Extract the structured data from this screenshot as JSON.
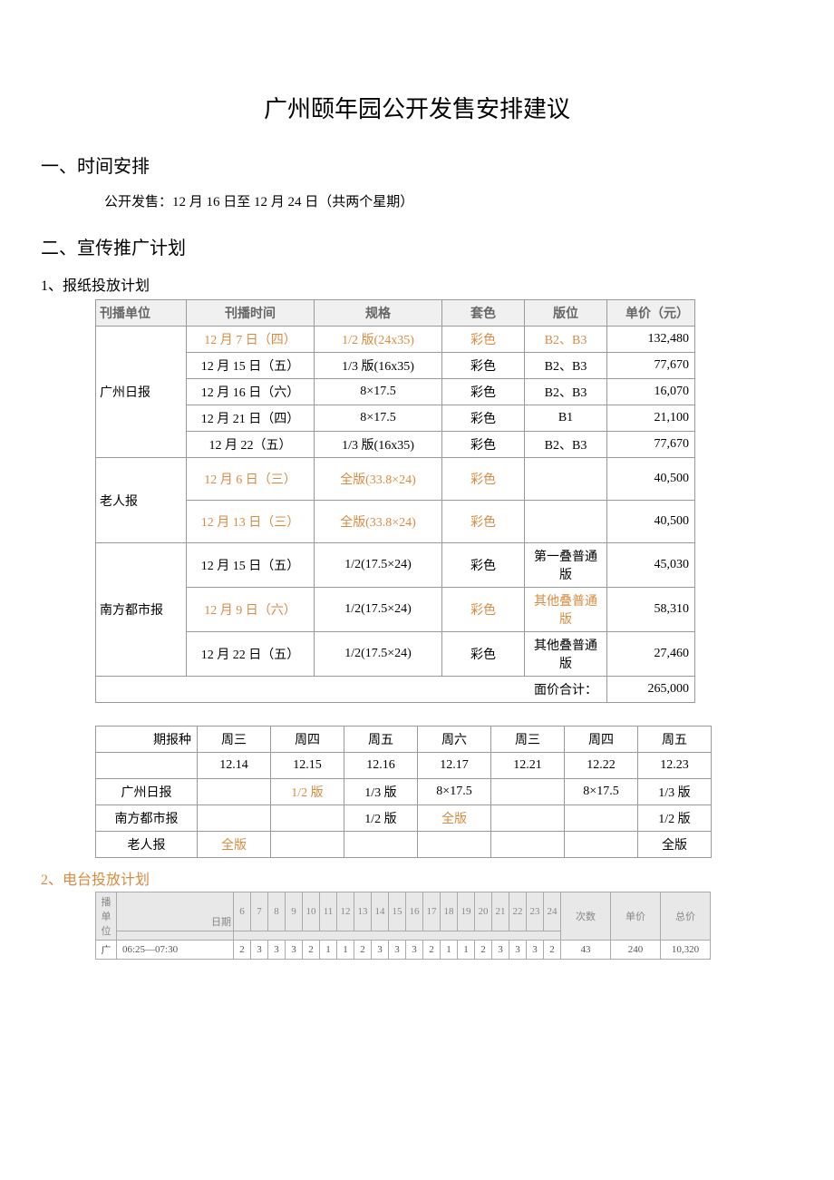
{
  "title": "广州颐年园公开发售安排建议",
  "h2a": "一、时间安排",
  "sale_line_prefix": "公开发售：",
  "sale_line_dates": "12 月 16 日至 12 月 24 日（共两个星期）",
  "h2b": "二、宣传推广计划",
  "s1": "1、报纸投放计划",
  "t1_headers": {
    "a": "刊播单位",
    "b": "刊播时间",
    "c": "规格",
    "d": "套色",
    "e": "版位",
    "f": "单价（元）"
  },
  "t1": [
    {
      "pub": "广州日报",
      "time": "12 月 7 日（四）",
      "spec": "1/2 版(24x35)",
      "color": "彩色",
      "pos": "B2、B3",
      "price": "132,480",
      "orange": true
    },
    {
      "pub": "",
      "time": "12 月 15 日（五）",
      "spec": "1/3 版(16x35)",
      "color": "彩色",
      "pos": "B2、B3",
      "price": "77,670"
    },
    {
      "pub": "",
      "time": "12 月 16 日（六）",
      "spec": "8×17.5",
      "color": "彩色",
      "pos": "B2、B3",
      "price": "16,070"
    },
    {
      "pub": "",
      "time": "12 月 21 日（四）",
      "spec": "8×17.5",
      "color": "彩色",
      "pos": "B1",
      "price": "21,100"
    },
    {
      "pub": "",
      "time": "12 月 22（五）",
      "spec": "1/3 版(16x35)",
      "color": "彩色",
      "pos": "B2、B3",
      "price": "77,670"
    },
    {
      "pub": "老人报",
      "time": "12 月 6 日（三）",
      "spec": "全版(33.8×24)",
      "color": "彩色",
      "pos": "",
      "price": "40,500",
      "orange": true,
      "tall": true
    },
    {
      "pub": "",
      "time": "12 月 13 日（三）",
      "spec": "全版(33.8×24)",
      "color": "彩色",
      "pos": "",
      "price": "40,500",
      "orange": true,
      "tall": true
    },
    {
      "pub": "南方都市报",
      "time": "12 月 15 日（五）",
      "spec": "1/2(17.5×24)",
      "color": "彩色",
      "pos": "第一叠普通版",
      "price": "45,030",
      "tall": true
    },
    {
      "pub": "",
      "time": "12 月 9 日（六）",
      "spec": "1/2(17.5×24)",
      "color": "彩色",
      "pos": "其他叠普通版",
      "price": "58,310",
      "orange": true,
      "tall": true
    },
    {
      "pub": "",
      "time": "12 月 22 日（五）",
      "spec": "1/2(17.5×24)",
      "color": "彩色",
      "pos": "其他叠普通版",
      "price": "27,460",
      "tall": true
    }
  ],
  "t1_total_label": "面价合计：",
  "t1_total": "265,000",
  "t2_corner": "期报种",
  "t2_days": [
    "周三",
    "周四",
    "周五",
    "周六",
    "周三",
    "周四",
    "周五"
  ],
  "t2_dates": [
    "12.14",
    "12.15",
    "12.16",
    "12.17",
    "12.21",
    "12.22",
    "12.23"
  ],
  "t2_rows": [
    {
      "name": "广州日报",
      "cells": [
        "",
        "1/2 版",
        "1/3 版",
        "8×17.5",
        "",
        "8×17.5",
        "1/3 版"
      ],
      "orange_idx": 1
    },
    {
      "name": "南方都市报",
      "cells": [
        "",
        "",
        "1/2 版",
        "全版",
        "",
        "",
        "1/2 版"
      ],
      "orange_idx": 3
    },
    {
      "name": "老人报",
      "cells": [
        "全版",
        "",
        "",
        "",
        "",
        "",
        "全版"
      ],
      "orange_idx": 0
    }
  ],
  "s2": "2、电台投放计划",
  "t3_head": {
    "a": "播",
    "b": "单",
    "c": "位",
    "d": "日期",
    "e": "次数",
    "f": "单价",
    "g": "总价"
  },
  "t3_dates": [
    "6",
    "7",
    "8",
    "9",
    "10",
    "11",
    "12",
    "13",
    "14",
    "15",
    "16",
    "17",
    "18",
    "19",
    "20",
    "21",
    "22",
    "23",
    "24"
  ],
  "t3_row": {
    "pub": "广",
    "time": "06:25—07:30",
    "vals": [
      "2",
      "3",
      "3",
      "3",
      "2",
      "1",
      "1",
      "2",
      "3",
      "3",
      "3",
      "2",
      "1",
      "1",
      "2",
      "3",
      "3",
      "3",
      "2"
    ],
    "cnt": "43",
    "price": "240",
    "total": "10,320"
  }
}
